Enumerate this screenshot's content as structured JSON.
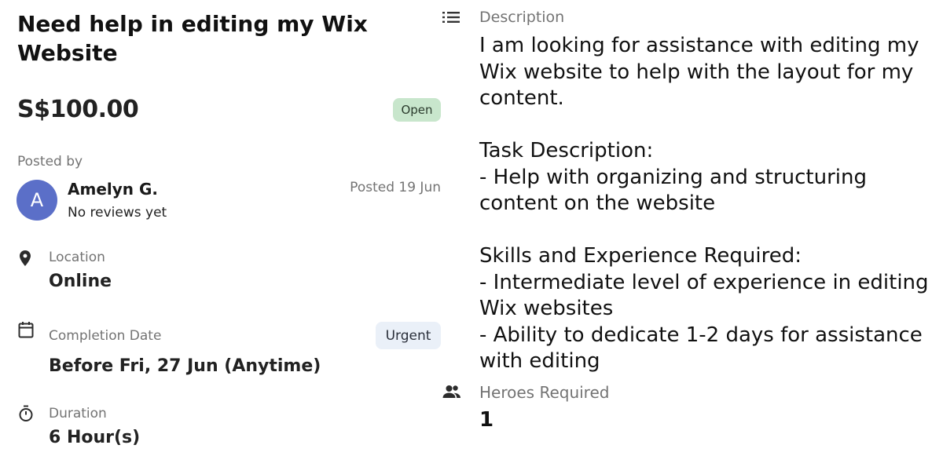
{
  "task": {
    "title": "Need help in editing my Wix Website",
    "price": "S$100.00",
    "status_badge": "Open"
  },
  "poster": {
    "label": "Posted by",
    "avatar_initial": "A",
    "name": "Amelyn G.",
    "reviews": "No reviews yet",
    "posted_date": "Posted 19 Jun"
  },
  "location": {
    "label": "Location",
    "value": "Online",
    "icon": "location-pin-icon"
  },
  "completion": {
    "label": "Completion Date",
    "value": "Before Fri, 27 Jun (Anytime)",
    "badge": "Urgent",
    "icon": "calendar-icon"
  },
  "duration": {
    "label": "Duration",
    "value": "6 Hour(s)",
    "icon": "timer-icon"
  },
  "description": {
    "label": "Description",
    "icon": "list-icon",
    "text": "I am looking for assistance with editing my Wix website to help with the layout for my content.\n\nTask Description:\n- Help with organizing and structuring content on the website\n\nSkills and Experience Required:\n- Intermediate level of experience in editing Wix websites\n- Ability to dedicate 1-2 days for assistance with editing"
  },
  "heroes": {
    "label": "Heroes Required",
    "value": "1",
    "icon": "people-icon"
  },
  "colors": {
    "open_badge_bg": "#c8e6cc",
    "urgent_badge_bg": "#eaf0f8",
    "avatar_bg": "#5b6fc8"
  }
}
